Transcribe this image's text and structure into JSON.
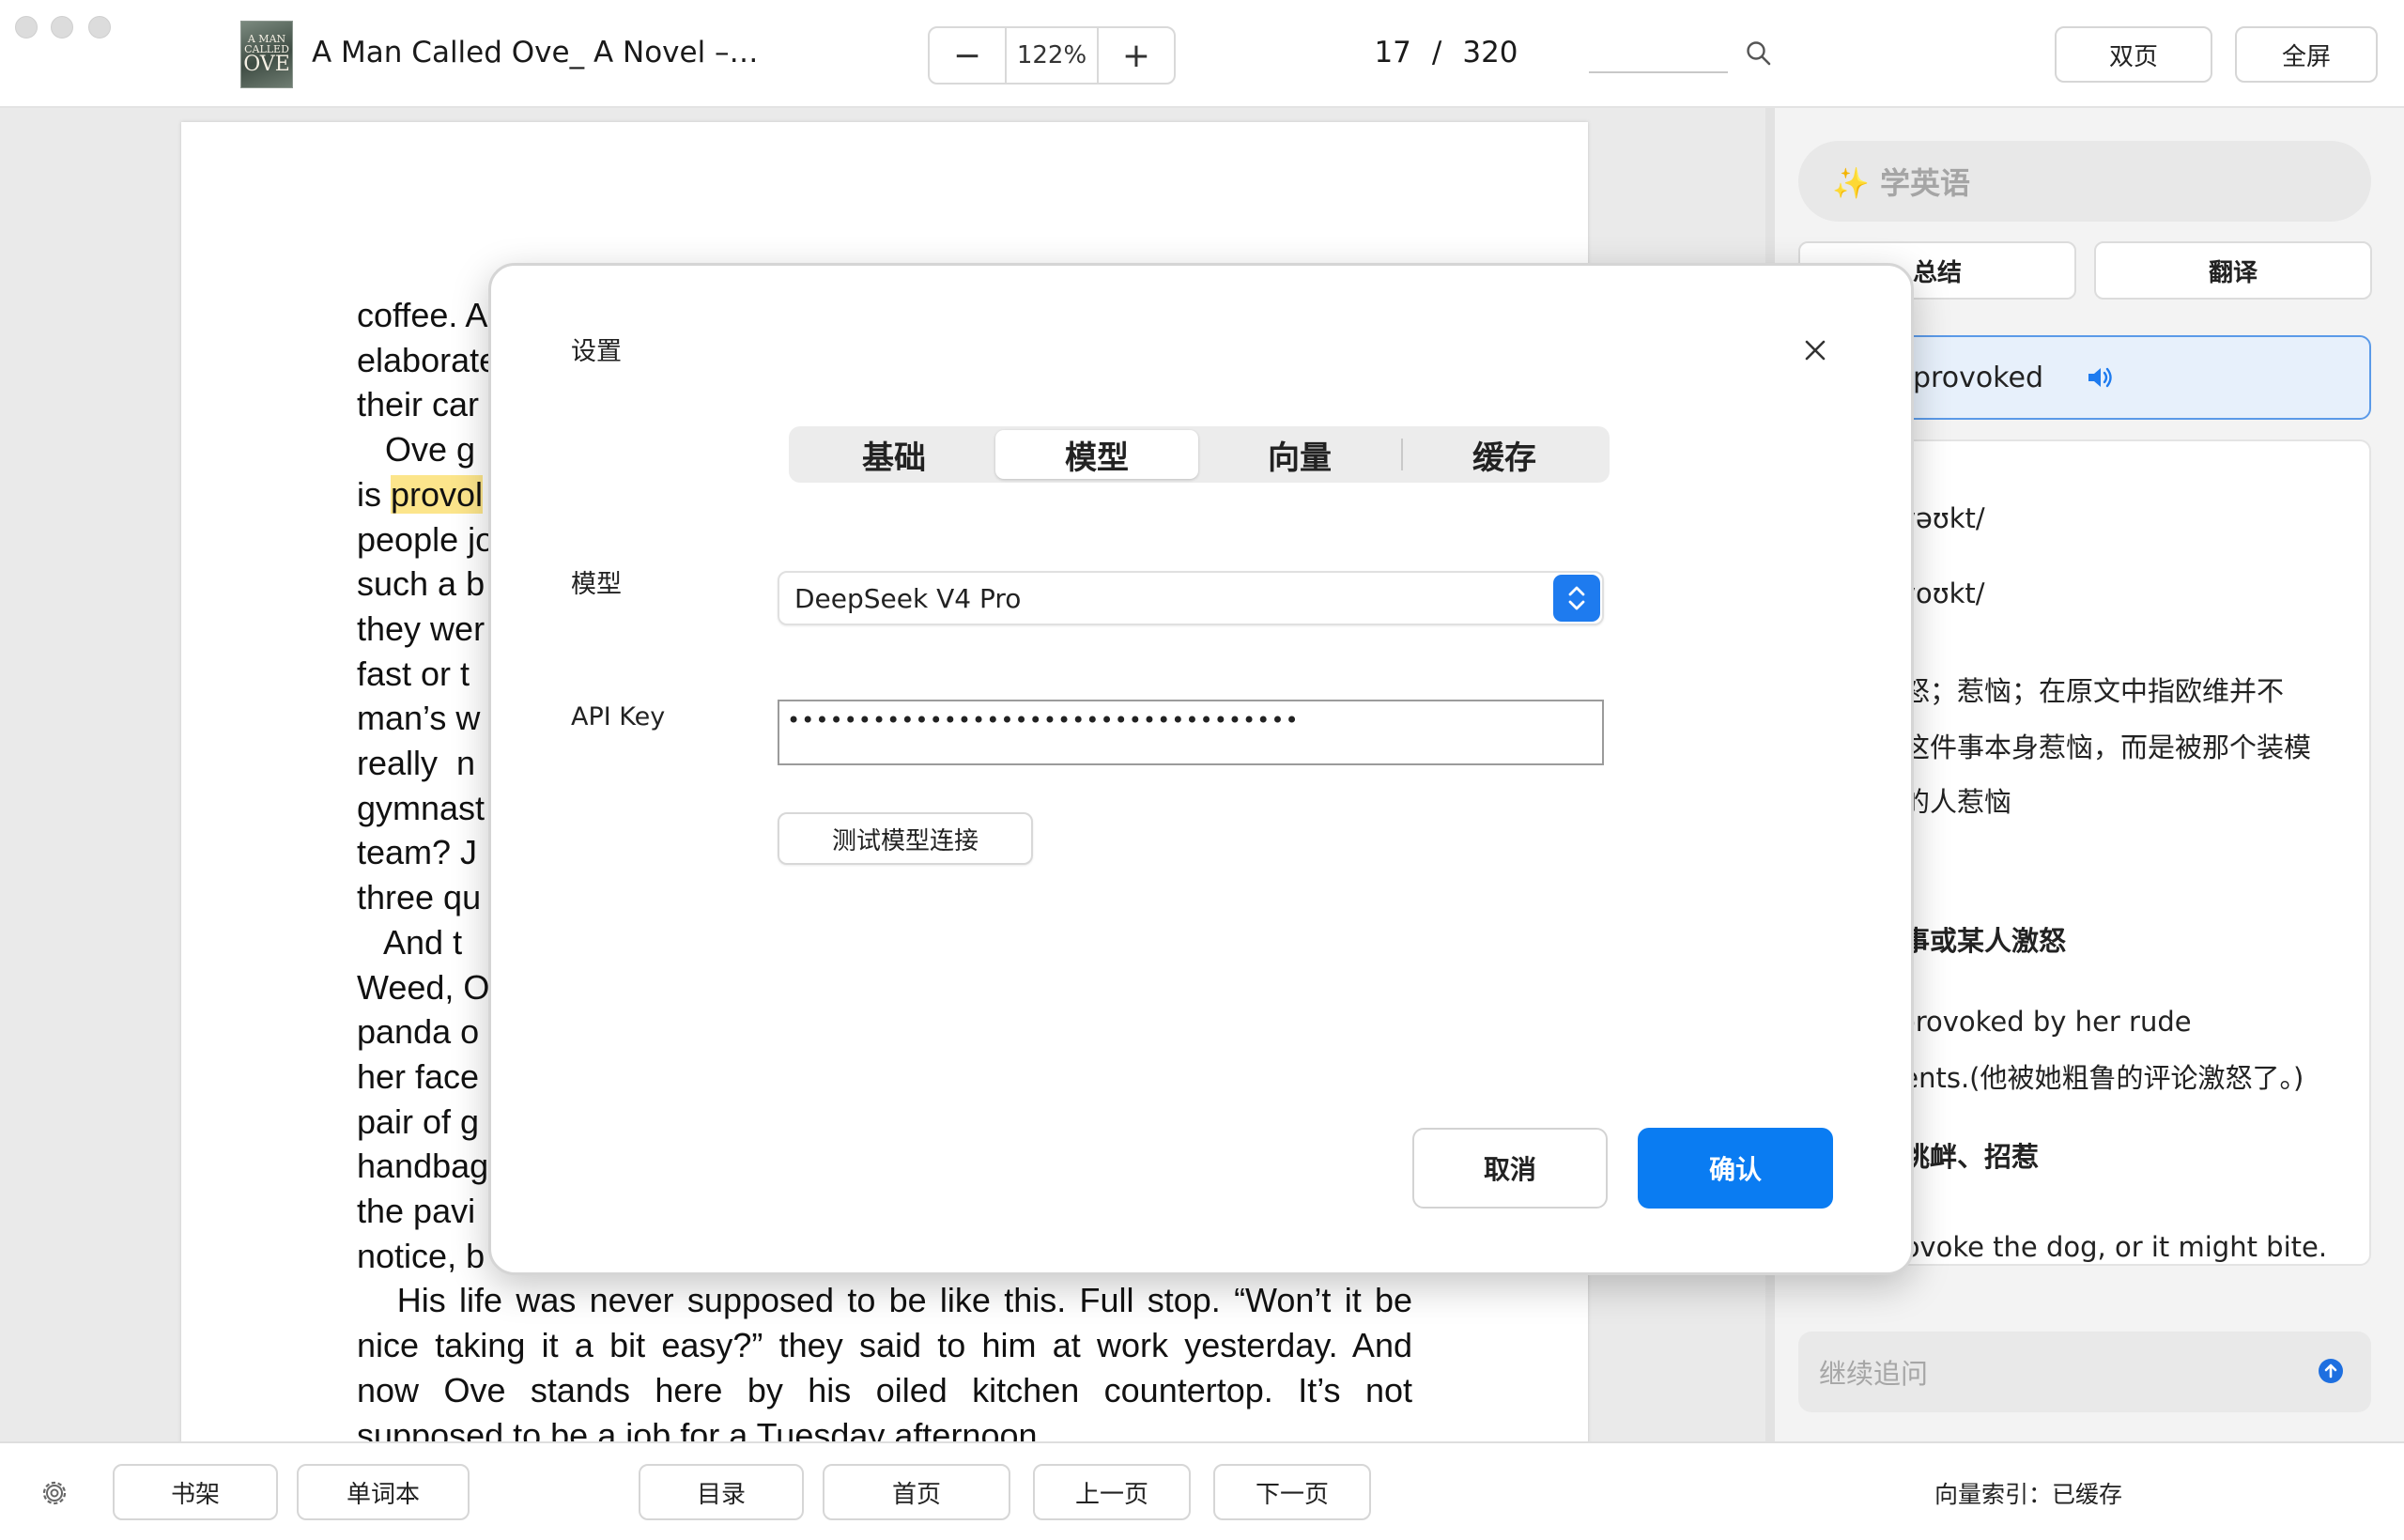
{
  "app": {
    "book_title": "A Man Called Ove_ A Novel –…",
    "book_cover_text_top": "A MAN CALLED",
    "book_cover_text_bottom": "OVE"
  },
  "toolbar": {
    "zoom_minus": "−",
    "zoom_value": "122%",
    "zoom_plus": "+",
    "current_page": "17",
    "page_separator": "/",
    "total_pages": "320",
    "search_icon": "search-icon",
    "double_page_label": "双页",
    "fullscreen_label": "全屏"
  },
  "reader": {
    "lines": [
      {
        "text": "coffee. A"
      },
      {
        "text": "elaborate"
      },
      {
        "text": "their car"
      },
      {
        "text": "   Ove g"
      },
      {
        "pre": "is ",
        "highlight": "provol",
        "post": ""
      },
      {
        "text": "people jo"
      },
      {
        "text": "such a b"
      },
      {
        "text": "they wer"
      },
      {
        "text": "fast or t"
      },
      {
        "text": "man’s w"
      },
      {
        "text": "really  n"
      },
      {
        "text": "gymnast"
      },
      {
        "text": "team? J"
      },
      {
        "text": "three qu"
      },
      {
        "text": "   And t"
      },
      {
        "text": "Weed, O"
      },
      {
        "text": "panda o"
      },
      {
        "text": "her face"
      },
      {
        "text": "pair of g"
      },
      {
        "text": "handbag"
      },
      {
        "text": "the pavi"
      },
      {
        "text": "notice, b"
      }
    ],
    "full_lines": [
      "   His life was never supposed to be like this. Full stop. “Won’t it be",
      "nice taking it a bit easy?” they said to him at work yesterday. And",
      "now Ove stands here by his oiled kitchen countertop. It’s not",
      "supposed to be a job for a Tuesday afternoon."
    ]
  },
  "panel": {
    "learn_label": "✨ 学英语",
    "summary_label": "总结",
    "translate_label": "翻译",
    "word": "provoked",
    "speaker_icon": "speaker-icon",
    "explanation": [
      {
        "text": "ə'vəʊkt/",
        "bold": false
      },
      {
        "text": "ə'voʊkt/",
        "bold": false
      },
      {
        "text": "激怒；惹恼；在原文中指欧维并不",
        "bold": false
      },
      {
        "text": "步这件事本身惹恼，而是被那个装模",
        "bold": false
      },
      {
        "text": "步的人惹恼",
        "bold": false
      },
      {
        "text": "法：",
        "bold": true
      },
      {
        "text": "某事或某人激怒",
        "bold": true
      },
      {
        "text": "s provoked by her rude",
        "bold": false
      },
      {
        "text": "ments.(他被她粗鲁的评论激怒了。)",
        "bold": false
      },
      {
        "text": "意挑衅、招惹",
        "bold": true
      },
      {
        "text": "provoke the dog, or it might bite.",
        "bold": false
      },
      {
        "text": "惹那条狗，它会咬人的。)",
        "bold": false
      }
    ],
    "followup_placeholder": "继续追问"
  },
  "bottom": {
    "bookshelf_label": "书架",
    "vocab_label": "单词本",
    "toc_label": "目录",
    "home_label": "首页",
    "prev_label": "上一页",
    "next_label": "下一页",
    "vector_status": "向量索引：已缓存"
  },
  "modal": {
    "title": "设置",
    "tabs": [
      "基础",
      "模型",
      "向量",
      "缓存"
    ],
    "active_tab": "模型",
    "model_label": "模型",
    "model_value": "DeepSeek V4 Pro",
    "api_key_label": "API Key",
    "api_key_value": "••••••••••••••••••••••••••••••••••••",
    "test_button": "测试模型连接",
    "cancel_button": "取消",
    "confirm_button": "确认"
  },
  "colors": {
    "accent": "#0a7cf2",
    "highlight": "#fce58b",
    "word_card_bg": "#e7f0fb",
    "word_card_border": "#5b9ae8"
  }
}
